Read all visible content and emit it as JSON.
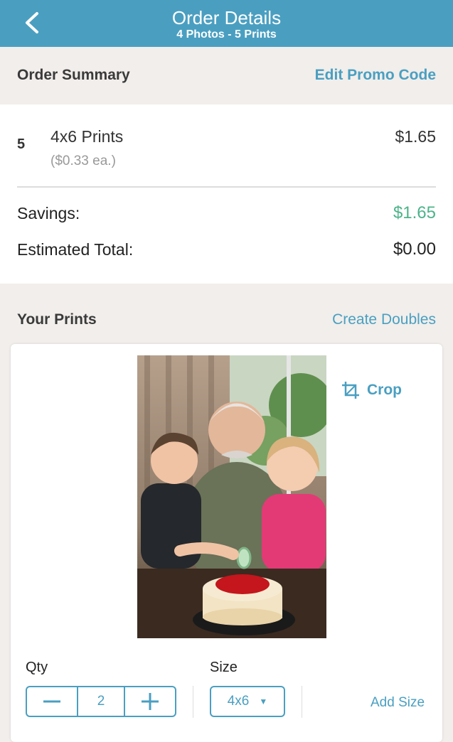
{
  "header": {
    "title": "Order Details",
    "subtitle": "4 Photos - 5 Prints",
    "back_icon": "chevron-left-icon"
  },
  "order_summary": {
    "title": "Order Summary",
    "promo_link": "Edit Promo Code",
    "item": {
      "quantity": "5",
      "name": "4x6 Prints",
      "each_price": "($0.33 ea.)",
      "price": "$1.65"
    },
    "savings_label": "Savings:",
    "savings_value": "$1.65",
    "total_label": "Estimated Total:",
    "total_value": "$0.00"
  },
  "prints": {
    "title": "Your Prints",
    "doubles_link": "Create Doubles",
    "card": {
      "crop_label": "Crop",
      "qty_label": "Qty",
      "qty_value": "2",
      "size_label": "Size",
      "size_value": "4x6",
      "add_size_label": "Add Size"
    }
  },
  "colors": {
    "accent": "#4a9fc1",
    "savings": "#4cb38a",
    "background": "#f1eeeb"
  }
}
